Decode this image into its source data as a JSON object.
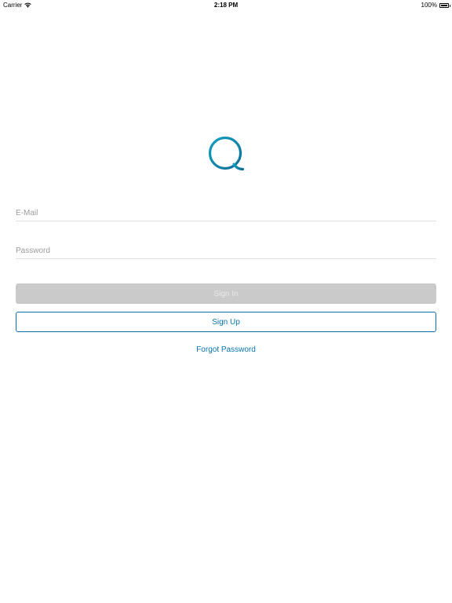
{
  "status_bar": {
    "carrier": "Carrier",
    "time": "2:18 PM",
    "battery": "100%",
    "battery_level": 1.0
  },
  "logo": {
    "icon": "q-logo-icon",
    "color": "#0a84a8"
  },
  "form": {
    "email_placeholder": "E-Mail",
    "email_value": "",
    "password_placeholder": "Password",
    "password_value": "",
    "sign_in_label": "Sign In",
    "sign_up_label": "Sign Up",
    "forgot_password_label": "Forgot Password"
  },
  "colors": {
    "accent": "#0a74a9",
    "disabled_button": "#cacaca",
    "disabled_text": "#e9e9e9"
  }
}
